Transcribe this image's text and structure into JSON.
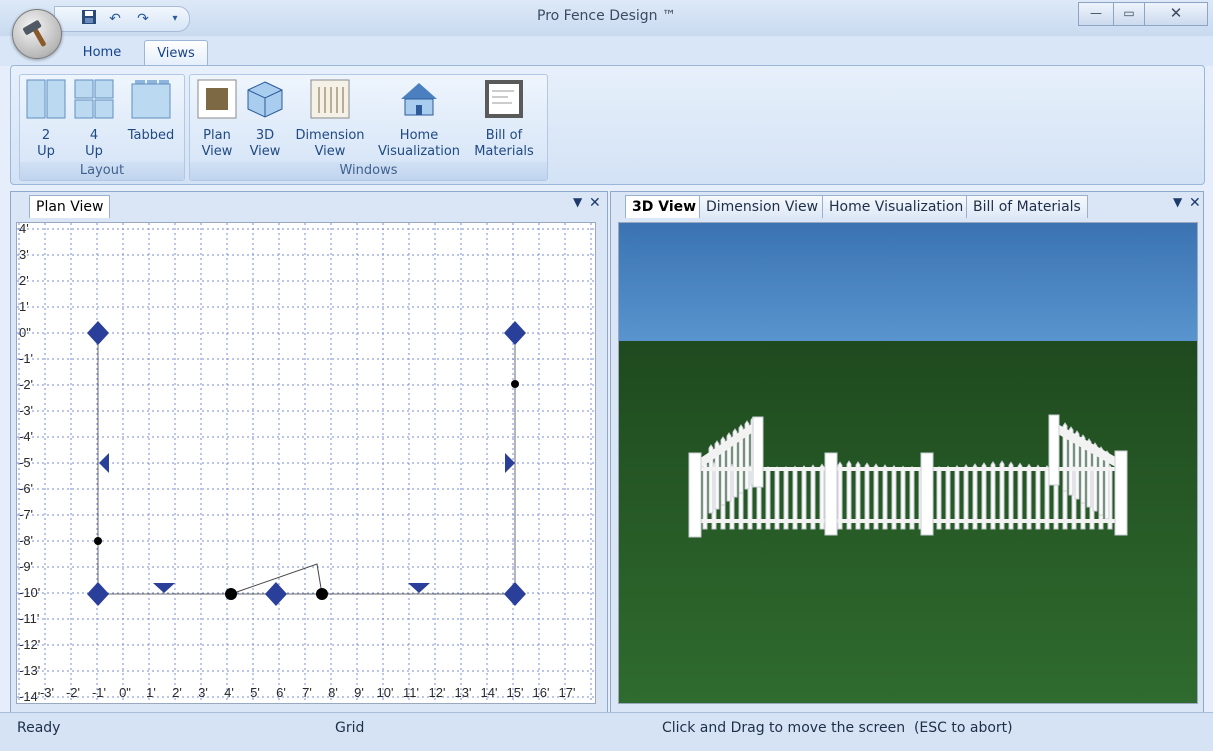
{
  "window": {
    "title": "Pro Fence Design ™"
  },
  "ribbon": {
    "tabs": [
      {
        "label": "Home"
      },
      {
        "label": "Views"
      }
    ],
    "groups": [
      {
        "label": "Layout",
        "buttons": [
          {
            "line1": "2",
            "line2": "Up"
          },
          {
            "line1": "4",
            "line2": "Up"
          },
          {
            "line1": "Tabbed",
            "line2": ""
          }
        ]
      },
      {
        "label": "Windows",
        "buttons": [
          {
            "line1": "Plan",
            "line2": "View"
          },
          {
            "line1": "3D",
            "line2": "View"
          },
          {
            "line1": "Dimension",
            "line2": "View"
          },
          {
            "line1": "Home",
            "line2": "Visualization"
          },
          {
            "line1": "Bill of",
            "line2": "Materials"
          }
        ]
      }
    ]
  },
  "left_pane": {
    "tabs": [
      {
        "label": "Plan View"
      }
    ],
    "y_ticks": [
      "4'",
      "3'",
      "2'",
      "1'",
      "0\"",
      "-1'",
      "-2'",
      "-3'",
      "-4'",
      "-5'",
      "-6'",
      "-7'",
      "-8'",
      "-9'",
      "-10'",
      "-11'",
      "-12'",
      "-13'",
      "-14'"
    ],
    "x_ticks": [
      "-3'",
      "-2'",
      "-1'",
      "0\"",
      "1'",
      "2'",
      "3'",
      "4'",
      "5'",
      "6'",
      "7'",
      "8'",
      "9'",
      "10'",
      "11'",
      "12'",
      "13'",
      "14'",
      "15'",
      "16'",
      "17'"
    ]
  },
  "right_pane": {
    "tabs": [
      {
        "label": "3D View"
      },
      {
        "label": "Dimension View"
      },
      {
        "label": "Home Visualization"
      },
      {
        "label": "Bill of Materials"
      }
    ]
  },
  "status": {
    "left": "Ready",
    "middle": "Grid",
    "right": "Click and Drag to move the screen  (ESC to abort)"
  },
  "colors": {
    "accent": "#15428b",
    "handle": "#2a3f9a",
    "grass": "#285a2a",
    "sky": "#3c78b8"
  }
}
